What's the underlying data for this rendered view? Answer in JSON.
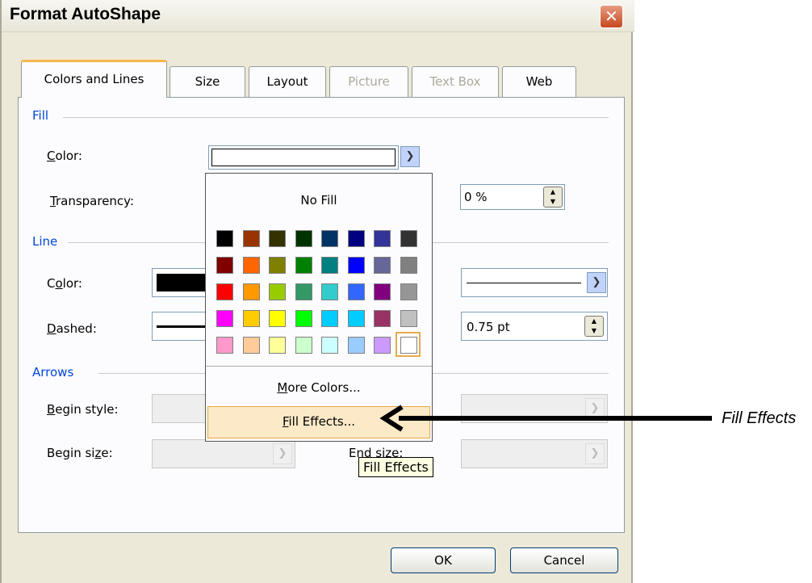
{
  "window": {
    "title": "Format AutoShape",
    "close_glyph": "✕"
  },
  "tabs": [
    {
      "label": "Colors and Lines",
      "active": true,
      "disabled": false
    },
    {
      "label": "Size",
      "active": false,
      "disabled": false
    },
    {
      "label": "Layout",
      "active": false,
      "disabled": false
    },
    {
      "label": "Picture",
      "active": false,
      "disabled": true
    },
    {
      "label": "Text Box",
      "active": false,
      "disabled": true
    },
    {
      "label": "Web",
      "active": false,
      "disabled": false
    }
  ],
  "fill": {
    "group": "Fill",
    "color_label_pre": "",
    "color_label_u": "C",
    "color_label_post": "olor:",
    "transparency_label_u": "T",
    "transparency_label_post": "ransparency:",
    "transparency_value": "0 %"
  },
  "line": {
    "group": "Line",
    "color_label_pre": "C",
    "color_label_u": "o",
    "color_label_post": "lor:",
    "dashed_label_u": "D",
    "dashed_label_post": "ashed:",
    "weight_value": "0.75 pt"
  },
  "arrows": {
    "group": "Arrows",
    "begin_style_label_u": "B",
    "begin_style_label_post": "egin style:",
    "begin_size_label_pre": "Begin si",
    "begin_size_label_u": "z",
    "begin_size_label_post": "e:",
    "end_size_label": "End size:"
  },
  "palette": {
    "no_fill": "No Fill",
    "more_colors_u": "M",
    "more_colors_post": "ore Colors...",
    "fill_effects_u": "F",
    "fill_effects_post": "ill Effects...",
    "rows": [
      [
        "#000000",
        "#993300",
        "#333300",
        "#003300",
        "#003366",
        "#000080",
        "#333399",
        "#333333"
      ],
      [
        "#800000",
        "#ff6600",
        "#808000",
        "#008000",
        "#008080",
        "#0000ff",
        "#666699",
        "#808080"
      ],
      [
        "#ff0000",
        "#ff9900",
        "#99cc00",
        "#339966",
        "#33cccc",
        "#3366ff",
        "#800080",
        "#969696"
      ],
      [
        "#ff00ff",
        "#ffcc00",
        "#ffff00",
        "#00ff00",
        "#00ccff",
        "#00ccff",
        "#993366",
        "#c0c0c0"
      ],
      [
        "#ff99cc",
        "#ffcc99",
        "#ffff99",
        "#ccffcc",
        "#ccffff",
        "#99ccff",
        "#cc99ff",
        "#ffffff"
      ]
    ],
    "selected": "#ffffff"
  },
  "tooltip": "Fill Effects",
  "buttons": {
    "ok": "OK",
    "cancel": "Cancel"
  },
  "annotation": "Fill Effects",
  "colors": {
    "accent_group": "#0046d5",
    "tab_highlight": "#f6b74f",
    "close": "#c6481f"
  }
}
